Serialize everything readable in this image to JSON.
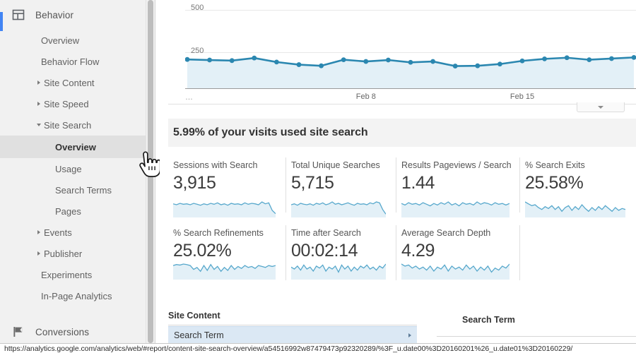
{
  "sidebar": {
    "section": {
      "label": "Behavior",
      "icon": "behavior-layout-icon",
      "accent_color": "#4285f4"
    },
    "items": [
      {
        "label": "Overview",
        "level": 1,
        "caret": "none",
        "selected": false
      },
      {
        "label": "Behavior Flow",
        "level": 1,
        "caret": "none",
        "selected": false
      },
      {
        "label": "Site Content",
        "level": 1,
        "caret": "right",
        "selected": false
      },
      {
        "label": "Site Speed",
        "level": 1,
        "caret": "right",
        "selected": false
      },
      {
        "label": "Site Search",
        "level": 1,
        "caret": "down",
        "selected": false
      },
      {
        "label": "Overview",
        "level": 2,
        "caret": "none",
        "selected": true
      },
      {
        "label": "Usage",
        "level": 2,
        "caret": "none",
        "selected": false
      },
      {
        "label": "Search Terms",
        "level": 2,
        "caret": "none",
        "selected": false
      },
      {
        "label": "Pages",
        "level": 2,
        "caret": "none",
        "selected": false
      },
      {
        "label": "Events",
        "level": 1,
        "caret": "right",
        "selected": false
      },
      {
        "label": "Publisher",
        "level": 1,
        "caret": "right",
        "selected": false
      },
      {
        "label": "Experiments",
        "level": 1,
        "caret": "none",
        "selected": false
      },
      {
        "label": "In-Page Analytics",
        "level": 1,
        "caret": "none",
        "selected": false
      }
    ],
    "bottom_section": {
      "label": "Conversions",
      "icon": "flag-icon"
    }
  },
  "main": {
    "headline": "5.99% of your visits used site search",
    "metrics_row1": [
      {
        "title": "Sessions with Search",
        "value": "3,915"
      },
      {
        "title": "Total Unique Searches",
        "value": "5,715"
      },
      {
        "title": "Results Pageviews / Search",
        "value": "1.44"
      },
      {
        "title": "% Search Exits",
        "value": "25.58%"
      }
    ],
    "metrics_row2": [
      {
        "title": "% Search Refinements",
        "value": "25.02%"
      },
      {
        "title": "Time after Search",
        "value": "00:02:14"
      },
      {
        "title": "Average Search Depth",
        "value": "4.29"
      }
    ],
    "tables": {
      "left_header": "Site Content",
      "left_row": "Search Term",
      "right_header": "Search Term"
    },
    "collapse_tab_icon": "chevron-down-icon"
  },
  "statusbar": {
    "url": "https://analytics.google.com/analytics/web/#report/content-site-search-overview/a54516992w87479473p92320289/%3F_u.date00%3D20160201%26_u.date01%3D20160229/"
  },
  "cursor": {
    "icon": "pointing-hand-cursor"
  },
  "chart_data": {
    "type": "line",
    "title": "",
    "xlabel": "",
    "ylabel": "",
    "ylim": [
      0,
      500
    ],
    "yticks": [
      250,
      500
    ],
    "grid": true,
    "line_color": "#2b87b0",
    "fill_color": "#e3f0f7",
    "marker": "circle",
    "xtick_labels": [
      "…",
      "Feb 8",
      "Feb 15"
    ],
    "xtick_positions": [
      0,
      8,
      15
    ],
    "x": [
      0,
      1,
      2,
      3,
      4,
      5,
      6,
      7,
      8,
      9,
      10,
      11,
      12,
      13,
      14,
      15,
      16,
      17,
      18,
      19,
      20
    ],
    "values": [
      200,
      196,
      192,
      210,
      182,
      164,
      156,
      198,
      186,
      196,
      180,
      186,
      154,
      156,
      168,
      190,
      204,
      212,
      198,
      206,
      214
    ],
    "series": [
      {
        "name": "Sessions with Search",
        "values": [
          200,
          196,
          192,
          210,
          182,
          164,
          156,
          198,
          186,
          196,
          180,
          186,
          154,
          156,
          168,
          190,
          204,
          212,
          198,
          206,
          214
        ]
      }
    ]
  },
  "sparklines": {
    "sessions_with_search": [
      26,
      24,
      27,
      25,
      26,
      24,
      27,
      25,
      23,
      26,
      24,
      27,
      25,
      28,
      24,
      26,
      23,
      27,
      25,
      26,
      24,
      28,
      25,
      27,
      26,
      24,
      30,
      26,
      28,
      12,
      5
    ],
    "total_unique_searches": [
      24,
      26,
      23,
      27,
      25,
      24,
      26,
      23,
      27,
      25,
      28,
      24,
      26,
      30,
      25,
      27,
      24,
      26,
      28,
      25,
      23,
      27,
      25,
      26,
      24,
      28,
      26,
      30,
      28,
      14,
      4
    ],
    "results_pageviews_per_search": [
      16,
      14,
      17,
      15,
      16,
      14,
      17,
      15,
      13,
      16,
      14,
      17,
      15,
      18,
      14,
      16,
      13,
      17,
      15,
      16,
      14,
      18,
      15,
      17,
      16,
      14,
      17,
      15,
      16,
      14,
      16
    ],
    "pct_search_exits": [
      30,
      26,
      22,
      24,
      18,
      14,
      20,
      16,
      22,
      14,
      20,
      10,
      18,
      22,
      12,
      20,
      14,
      24,
      16,
      10,
      18,
      12,
      20,
      14,
      22,
      16,
      10,
      18,
      12,
      16,
      14
    ],
    "pct_search_refinements": [
      26,
      28,
      27,
      29,
      28,
      26,
      18,
      22,
      14,
      26,
      16,
      28,
      18,
      24,
      14,
      22,
      16,
      26,
      18,
      24,
      20,
      26,
      22,
      24,
      20,
      26,
      24,
      22,
      26,
      24,
      26
    ],
    "time_after_search": [
      22,
      18,
      24,
      16,
      26,
      18,
      22,
      14,
      24,
      20,
      26,
      14,
      22,
      18,
      24,
      12,
      26,
      18,
      24,
      14,
      22,
      16,
      24,
      20,
      26,
      18,
      22,
      16,
      24,
      20,
      28
    ],
    "average_search_depth": [
      28,
      24,
      26,
      20,
      24,
      18,
      22,
      16,
      24,
      14,
      22,
      18,
      26,
      14,
      24,
      18,
      22,
      16,
      26,
      18,
      24,
      14,
      22,
      16,
      24,
      12,
      20,
      16,
      24,
      20,
      28
    ]
  }
}
